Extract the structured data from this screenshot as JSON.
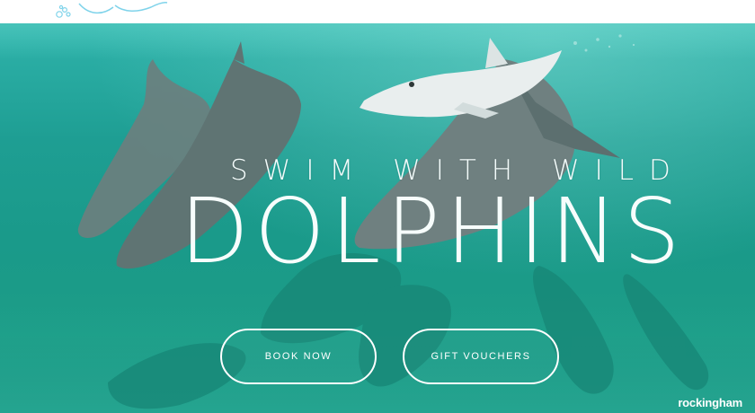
{
  "hero": {
    "tagline": "SWIM WITH WILD",
    "title": "DOLPHINS"
  },
  "actions": {
    "book_now": "BOOK NOW",
    "gift_vouchers": "GIFT VOUCHERS"
  },
  "partner": {
    "name": "rockingham"
  },
  "colors": {
    "water_top": "#2fb3ab",
    "water_bottom": "#1a8f7d",
    "text": "#ffffff",
    "logo": "#7fd3ea"
  },
  "icons": {
    "logo": "dolphin-bubbles-logo"
  }
}
